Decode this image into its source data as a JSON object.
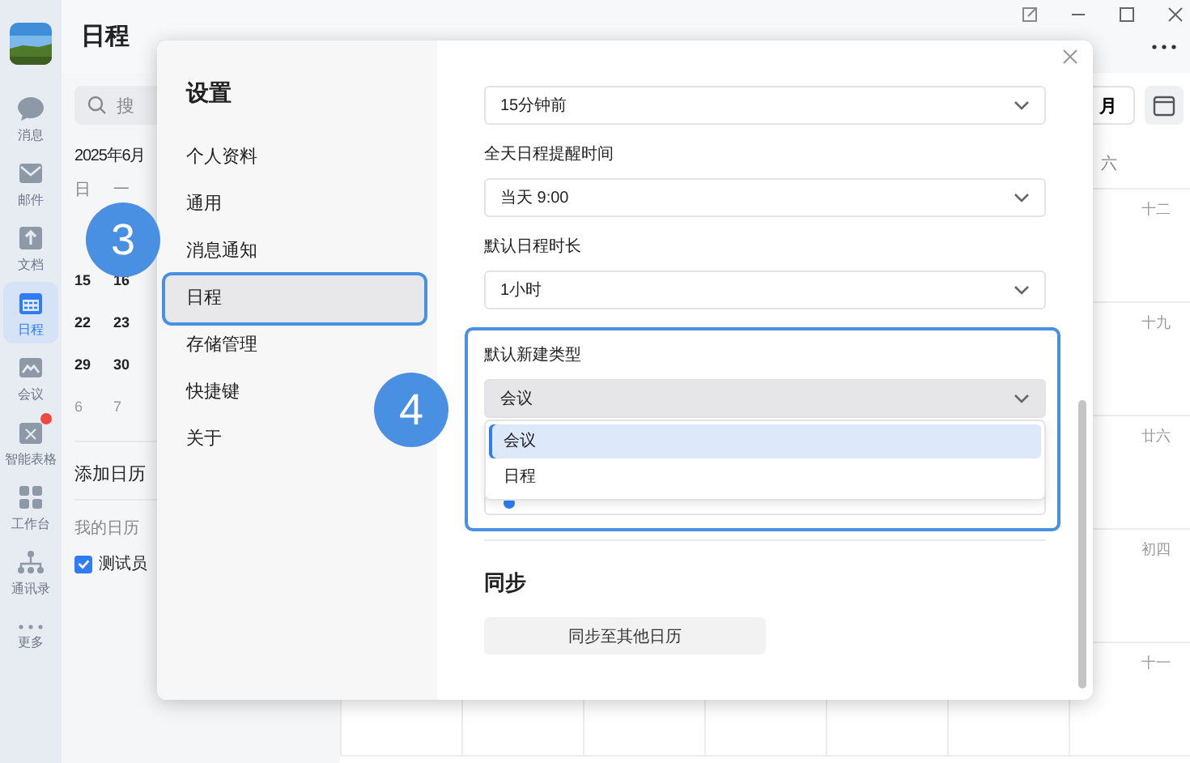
{
  "rail": {
    "items": [
      {
        "label": "消息",
        "kind": "chat",
        "selected": false,
        "badge": false
      },
      {
        "label": "邮件",
        "kind": "mail",
        "selected": false,
        "badge": false
      },
      {
        "label": "文档",
        "kind": "doc",
        "selected": false,
        "badge": false
      },
      {
        "label": "日程",
        "kind": "calendar",
        "selected": true,
        "badge": false
      },
      {
        "label": "会议",
        "kind": "meeting",
        "selected": false,
        "badge": false
      },
      {
        "label": "智能表格",
        "kind": "sheet",
        "selected": false,
        "badge": true
      },
      {
        "label": "工作台",
        "kind": "grid",
        "selected": false,
        "badge": false
      },
      {
        "label": "通讯录",
        "kind": "org",
        "selected": false,
        "badge": false
      },
      {
        "label": "更多",
        "kind": "more",
        "selected": false,
        "badge": false
      }
    ]
  },
  "header": {
    "title": "日程"
  },
  "sidebar": {
    "search": {
      "placeholder": "搜"
    },
    "month": "2025年6月",
    "weekdays": [
      "日",
      "一"
    ],
    "weeks": [
      [
        {
          "day": "15",
          "other_month": false
        },
        {
          "day": "16",
          "other_month": false
        }
      ],
      [
        {
          "day": "22",
          "other_month": false
        },
        {
          "day": "23",
          "other_month": false
        }
      ],
      [
        {
          "day": "29",
          "other_month": false
        },
        {
          "day": "30",
          "other_month": false
        }
      ],
      [
        {
          "day": "6",
          "other_month": true
        },
        {
          "day": "7",
          "other_month": true
        }
      ]
    ],
    "add_calendar": "添加日历",
    "my_calendars_label": "我的日历",
    "calendars": [
      {
        "name": "测试员",
        "checked": true
      }
    ]
  },
  "calendar": {
    "view_button": "月",
    "weekday": "六",
    "lunar": [
      "十二",
      "十九",
      "廿六",
      "初四",
      "十一"
    ]
  },
  "settings": {
    "title": "设置",
    "nav": [
      {
        "label": "个人资料",
        "selected": false,
        "highlighted": false
      },
      {
        "label": "通用",
        "selected": false,
        "highlighted": false
      },
      {
        "label": "消息通知",
        "selected": false,
        "highlighted": false
      },
      {
        "label": "日程",
        "selected": true,
        "highlighted": true
      },
      {
        "label": "存储管理",
        "selected": false,
        "highlighted": false
      },
      {
        "label": "快捷键",
        "selected": false,
        "highlighted": false
      },
      {
        "label": "关于",
        "selected": false,
        "highlighted": false
      }
    ],
    "fields": [
      {
        "value": "15分钟前",
        "highlighted": false,
        "open": false
      },
      {
        "label": "全天日程提醒时间",
        "value": "当天 9:00",
        "highlighted": false,
        "open": false
      },
      {
        "label": "默认日程时长",
        "value": "1小时",
        "highlighted": false,
        "open": false
      },
      {
        "label": "默认新建类型",
        "value": "会议",
        "highlighted": true,
        "open": true,
        "options": [
          {
            "label": "会议",
            "selected": true
          },
          {
            "label": "日程",
            "selected": false
          }
        ]
      }
    ],
    "sync": {
      "title": "同步",
      "button": "同步至其他日历"
    }
  },
  "annotations": [
    {
      "number": "3"
    },
    {
      "number": "4"
    }
  ]
}
